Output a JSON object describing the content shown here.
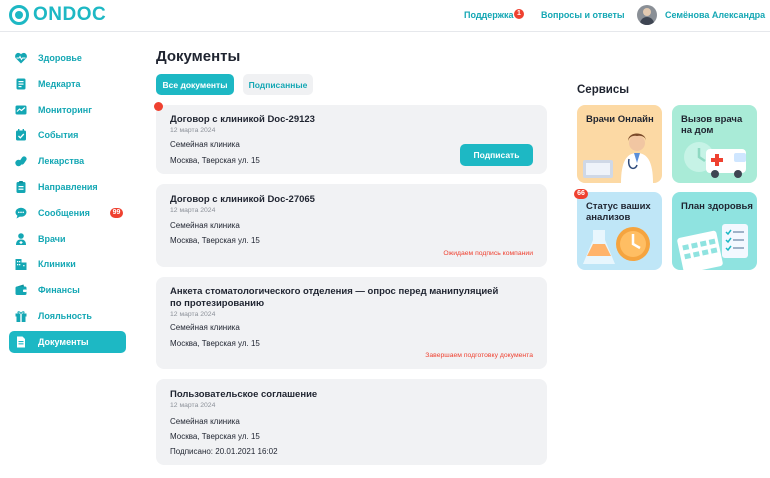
{
  "header": {
    "logo_text": "ONDOC",
    "support_label": "Поддержка",
    "support_badge": "1",
    "faq_label": "Вопросы и ответы",
    "user_name": "Семёнова Александра"
  },
  "sidebar": {
    "items": [
      {
        "label": "Здоровье",
        "icon": "heart-pulse-icon"
      },
      {
        "label": "Медкарта",
        "icon": "medcard-icon"
      },
      {
        "label": "Мониторинг",
        "icon": "monitoring-icon"
      },
      {
        "label": "События",
        "icon": "calendar-check-icon"
      },
      {
        "label": "Лекарства",
        "icon": "pills-icon"
      },
      {
        "label": "Направления",
        "icon": "clipboard-icon"
      },
      {
        "label": "Сообщения",
        "icon": "chat-icon",
        "badge": "99"
      },
      {
        "label": "Врачи",
        "icon": "doctor-icon"
      },
      {
        "label": "Клиники",
        "icon": "building-icon"
      },
      {
        "label": "Финансы",
        "icon": "wallet-icon"
      },
      {
        "label": "Лояльность",
        "icon": "gift-icon"
      },
      {
        "label": "Документы",
        "icon": "document-icon",
        "active": true
      }
    ]
  },
  "main": {
    "title": "Документы",
    "tabs": [
      {
        "label": "Все документы",
        "active": true
      },
      {
        "label": "Подписанные",
        "active": false
      }
    ],
    "documents": [
      {
        "title": "Договор с клиникой Doc-29123",
        "date": "12 марта 2024",
        "clinic": "Семейная клиника",
        "address": "Москва, Тверская ул. 15",
        "action_label": "Подписать",
        "unread": true
      },
      {
        "title": "Договор с клиникой Doc-27065",
        "date": "12 марта 2024",
        "clinic": "Семейная клиника",
        "address": "Москва, Тверская ул. 15",
        "status": "Ожидаем подпись компании"
      },
      {
        "title": "Анкета стоматологического отделения — опрос перед манипуляцией по протезированию",
        "date": "12 марта 2024",
        "clinic": "Семейная клиника",
        "address": "Москва, Тверская ул. 15",
        "status": "Завершаем  подготовку документа"
      },
      {
        "title": "Пользовательское соглашение",
        "date": "12 марта 2024",
        "clinic": "Семейная клиника",
        "address": "Москва, Тверская ул. 15",
        "signed": "Подписано: 20.01.2021 16:02"
      }
    ]
  },
  "services": {
    "title": "Сервисы",
    "tiles": [
      {
        "label": "Врачи Онлайн",
        "color": "#fcd9a4"
      },
      {
        "label": "Вызов врача на дом",
        "color": "#a9ebd7"
      },
      {
        "label": "Статус ваших анализов",
        "color": "#bfe6f7",
        "badge": "66"
      },
      {
        "label": "План здоровья",
        "color": "#8fe3e0"
      }
    ]
  },
  "colors": {
    "accent": "#1db8c4",
    "accent_text": "#14a7b4",
    "alert": "#ef4130",
    "card_bg": "#f1f2f4"
  }
}
